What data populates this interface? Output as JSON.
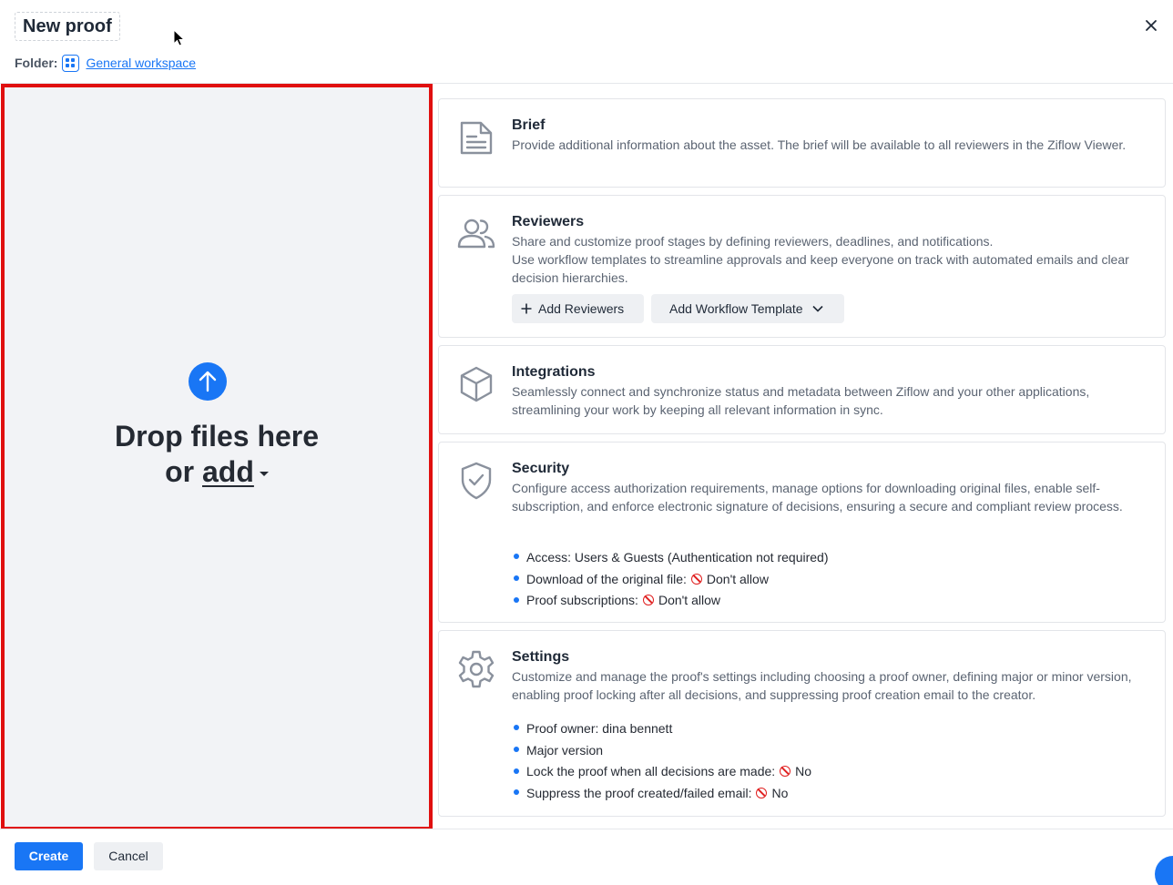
{
  "dialog": {
    "title": "New proof",
    "folder_label": "Folder:",
    "folder_name": "General workspace"
  },
  "dropzone": {
    "line1": "Drop files here",
    "line2_prefix": "or ",
    "add_label": "add"
  },
  "brief": {
    "title": "Brief",
    "description": "Provide additional information about the asset. The brief will be available to all reviewers in the Ziflow Viewer."
  },
  "reviewers": {
    "title": "Reviewers",
    "description_1": "Share and customize proof stages by defining reviewers, deadlines, and notifications.",
    "description_2": "Use workflow templates to streamline approvals and keep everyone on track with automated emails and clear decision hierarchies.",
    "add_reviewers_label": "Add Reviewers",
    "add_workflow_label": "Add Workflow Template"
  },
  "integrations": {
    "title": "Integrations",
    "description": "Seamlessly connect and synchronize status and metadata between Ziflow and your other applications, streamlining your work by keeping all relevant information in sync."
  },
  "security": {
    "title": "Security",
    "description": "Configure access authorization requirements, manage options for downloading original files, enable self-subscription, and enforce electronic signature of decisions, ensuring a secure and compliant review process.",
    "access": "Access: Users & Guests (Authentication not required)",
    "download_label": "Download of the original file:",
    "download_value": "Don't allow",
    "subscriptions_label": "Proof subscriptions:",
    "subscriptions_value": "Don't allow"
  },
  "settings": {
    "title": "Settings",
    "description": "Customize and manage the proof's settings including choosing a proof owner, defining major or minor version, enabling proof locking after all decisions, and suppressing proof creation email to the creator.",
    "owner": "Proof owner: dina bennett",
    "version": "Major version",
    "lock_label": "Lock the proof when all decisions are made:",
    "lock_value": "No",
    "suppress_label": "Suppress the proof created/failed email:",
    "suppress_value": "No"
  },
  "footer": {
    "create_label": "Create",
    "cancel_label": "Cancel"
  },
  "colors": {
    "accent": "#1976f5",
    "highlight_border": "#e00f0f",
    "deny": "#e02020"
  },
  "icons": [
    "close-icon",
    "folder-icon",
    "upload-arrow-icon",
    "caret-down-icon",
    "document-icon",
    "users-icon",
    "plus-icon",
    "chevron-down-icon",
    "cube-icon",
    "shield-check-icon",
    "gear-icon",
    "no-entry-icon"
  ]
}
